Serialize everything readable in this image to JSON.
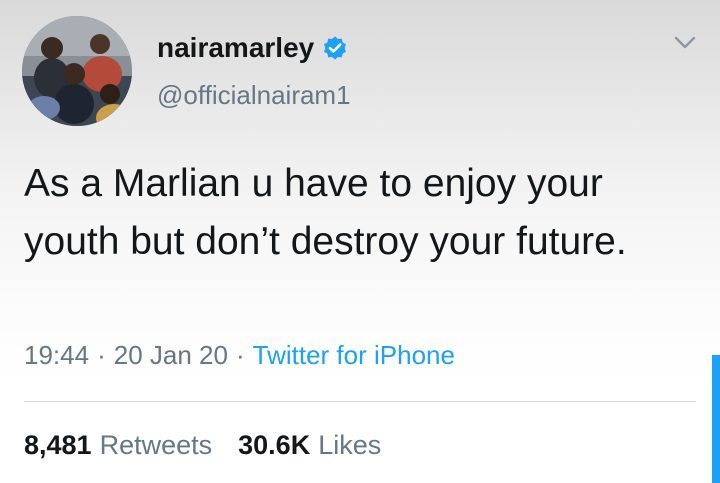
{
  "tweet": {
    "display_name": "nairamarley",
    "handle": "@officialnairam1",
    "verified": true,
    "text": "As a Marlian u have to enjoy your youth but don’t destroy your future.",
    "time": "19:44",
    "separator": "·",
    "date": "20 Jan 20",
    "source": "Twitter for iPhone",
    "retweets_count": "8,481",
    "retweets_label": "Retweets",
    "likes_count": "30.6K",
    "likes_label": "Likes"
  },
  "icons": {
    "verified": "verified-badge-icon",
    "more": "chevron-down-icon"
  },
  "colors": {
    "accent": "#1da1f2",
    "secondary_text": "#657786",
    "primary_text": "#14171a"
  }
}
